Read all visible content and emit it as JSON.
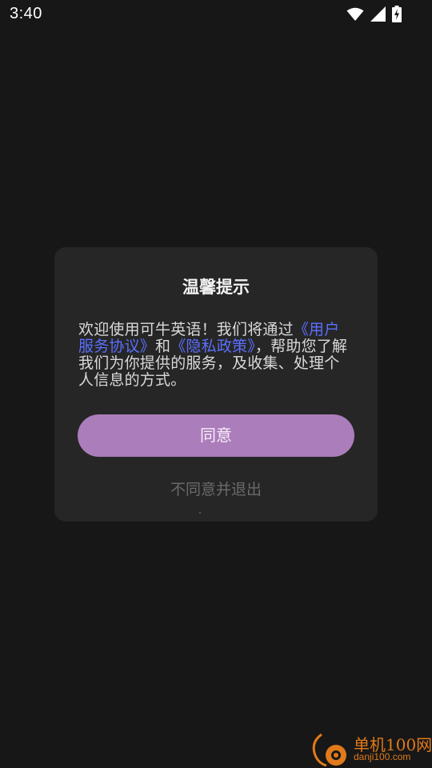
{
  "status_bar": {
    "time": "3:40",
    "icons": [
      "wifi-icon",
      "cell-signal-icon",
      "battery-charging-icon"
    ]
  },
  "dialog": {
    "title": "温馨提示",
    "message": {
      "text_1": "欢迎使用可牛英语！我们将通过",
      "link_1": "《用户服务协议》",
      "text_2": "和",
      "link_2": "《隐私政策》",
      "text_3": "，帮助您了解我们为你提供的服务，及收集、处理个人信息的方式。"
    },
    "agree_label": "同意",
    "decline_label": "不同意并退出"
  },
  "watermark": {
    "name": "单机100网",
    "url": "danji100.com"
  },
  "colors": {
    "background": "#171717",
    "dialog": "#262626",
    "accent_button": "#ab7dba",
    "link": "#5b6fff",
    "watermark": "#e07a1a"
  }
}
